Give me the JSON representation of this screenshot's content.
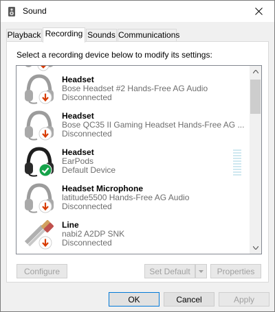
{
  "window": {
    "title": "Sound",
    "close_icon": "close-icon",
    "app_icon": "speaker-icon"
  },
  "tabs": [
    {
      "label": "Playback",
      "active": false
    },
    {
      "label": "Recording",
      "active": true
    },
    {
      "label": "Sounds",
      "active": false
    },
    {
      "label": "Communications",
      "active": false
    }
  ],
  "panel": {
    "instruction": "Select a recording device below to modify its settings:"
  },
  "devices": [
    {
      "name": "Headset",
      "description": "Bose Headset #2 Hands-Free AG Audio",
      "status": "Disconnected",
      "icon": "headset-icon",
      "badge": "disconnected-badge-icon"
    },
    {
      "name": "Headset",
      "description": "Bose QC35 II Gaming Headset Hands-Free AG ...",
      "status": "Disconnected",
      "icon": "headset-icon",
      "badge": "disconnected-badge-icon"
    },
    {
      "name": "Headset",
      "description": "EarPods",
      "status": "Default Device",
      "icon": "headset-icon",
      "badge": "default-check-icon"
    },
    {
      "name": "Headset Microphone",
      "description": "latitude5500 Hands-Free AG Audio",
      "status": "Disconnected",
      "icon": "headset-icon",
      "badge": "disconnected-badge-icon"
    },
    {
      "name": "Line",
      "description": "nabi2 A2DP SNK",
      "status": "Disconnected",
      "icon": "line-cable-icon",
      "badge": "disconnected-badge-icon"
    }
  ],
  "buttons": {
    "configure": "Configure",
    "set_default": "Set Default",
    "properties": "Properties",
    "ok": "OK",
    "cancel": "Cancel",
    "apply": "Apply"
  },
  "colors": {
    "disconnected_red": "#d83b01",
    "default_green": "#16a34a",
    "accent": "#0078d7"
  }
}
